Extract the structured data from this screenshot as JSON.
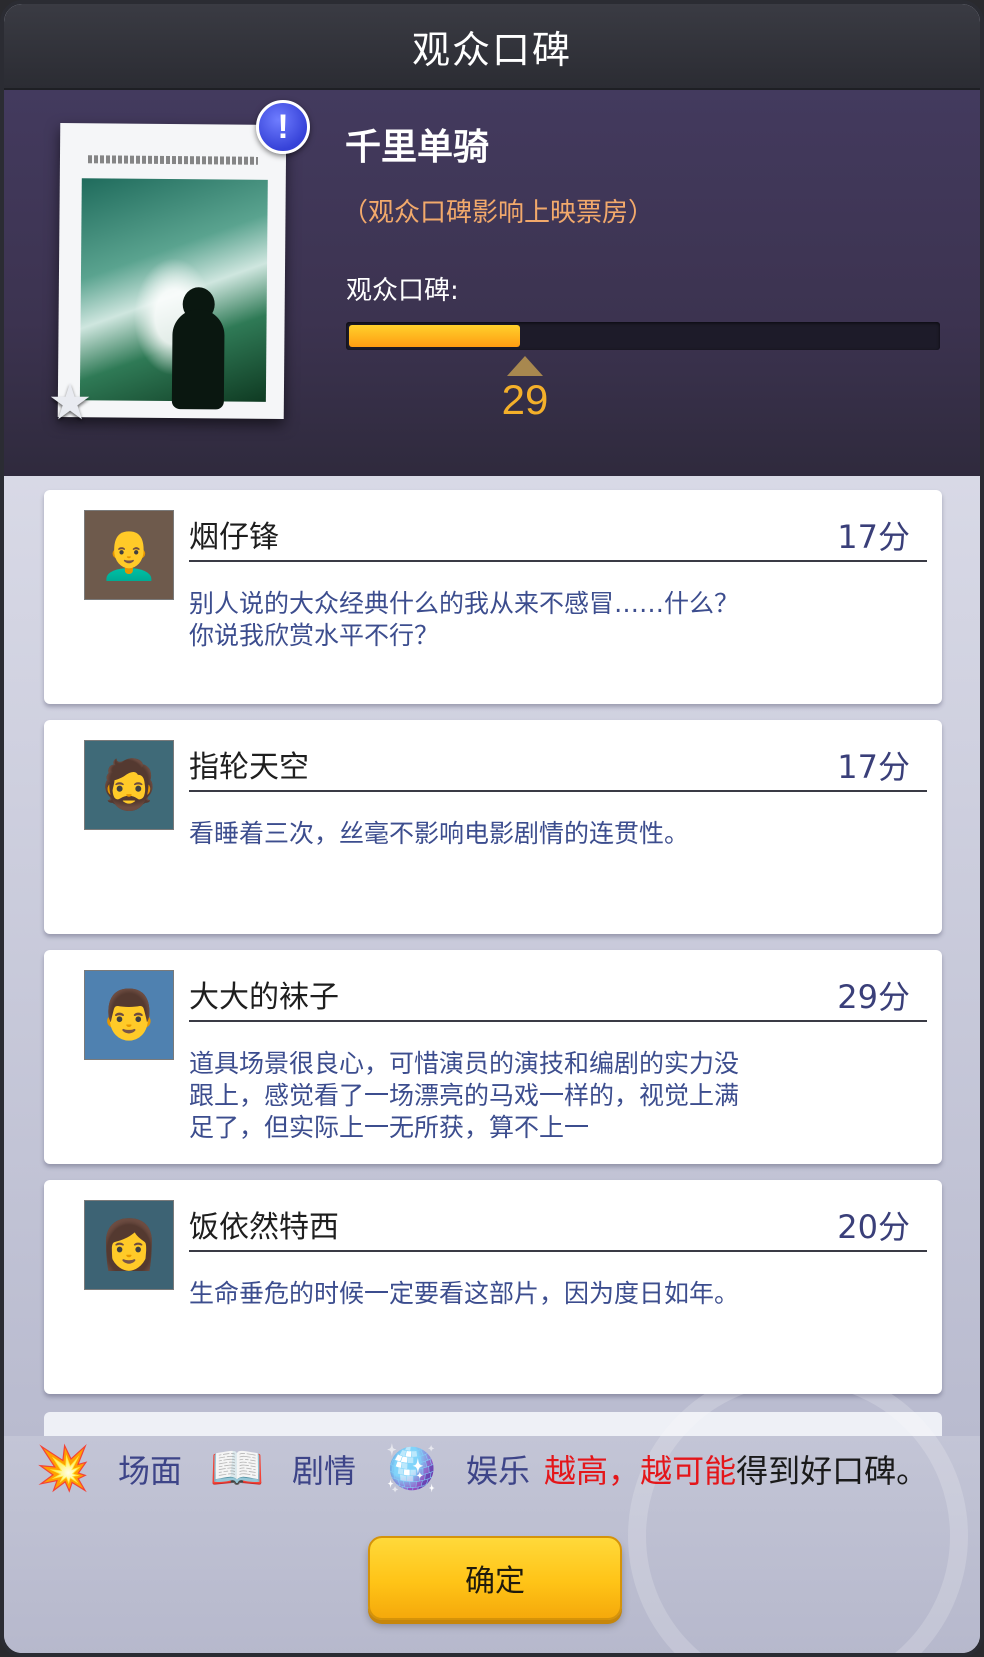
{
  "header": {
    "title": "观众口碑"
  },
  "movie": {
    "title": "千里单骑",
    "note": "（观众口碑影响上映票房）",
    "rating_label": "观众口碑:",
    "rating_value": "29",
    "rating_fraction": 0.29,
    "alert_glyph": "!",
    "star_glyph": "★",
    "poster_icon": "poster-image",
    "accent_color": "#f4b02a"
  },
  "reviews": [
    {
      "name": "烟仔锋",
      "score": "17分",
      "text": "别人说的大众经典什么的我从来不感冒……什么？你说我欣赏水平不行？",
      "avatar_icon": "bald-man-avatar",
      "avatar_glyph": "👨‍🦲",
      "avatar_bg": "#6e5a4c"
    },
    {
      "name": "指轮天空",
      "score": "17分",
      "text": "看睡着三次，丝毫不影响电影剧情的连贯性。",
      "avatar_icon": "glasses-man-avatar",
      "avatar_glyph": "🧔",
      "avatar_bg": "#3f6a78"
    },
    {
      "name": "大大的袜子",
      "score": "29分",
      "text": "道具场景很良心，可惜演员的演技和编剧的实力没跟上，感觉看了一场漂亮的马戏一样的，视觉上满足了，但实际上一无所获，算不上一",
      "avatar_icon": "dark-hair-man-avatar",
      "avatar_glyph": "👨",
      "avatar_bg": "#4f81b0"
    },
    {
      "name": "饭依然特西",
      "score": "20分",
      "text": "生命垂危的时候一定要看这部片，因为度日如年。",
      "avatar_icon": "woman-avatar",
      "avatar_glyph": "👩",
      "avatar_bg": "#3d6374"
    }
  ],
  "legend": {
    "items": [
      {
        "label": "场面",
        "icon": "explosion-icon",
        "glyph": "💥"
      },
      {
        "label": "剧情",
        "icon": "open-book-icon",
        "glyph": "📖"
      },
      {
        "label": "娱乐",
        "icon": "disco-ball-icon",
        "glyph": "🪩"
      }
    ],
    "highlight_1": "越高，",
    "highlight_2": "越可能",
    "suffix": "得到好口碑。"
  },
  "buttons": {
    "confirm": "确定"
  }
}
